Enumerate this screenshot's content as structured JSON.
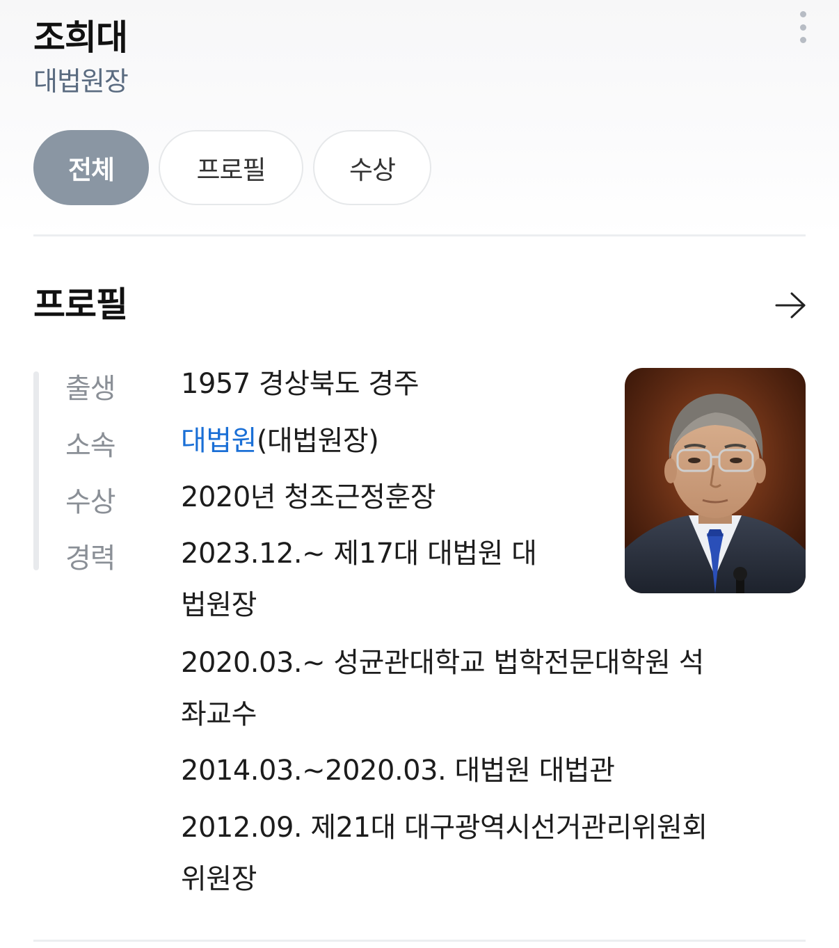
{
  "header": {
    "name": "조희대",
    "title": "대법원장",
    "more_icon": "more-vertical-icon"
  },
  "tabs": [
    {
      "label": "전체",
      "active": true
    },
    {
      "label": "프로필",
      "active": false
    },
    {
      "label": "수상",
      "active": false
    }
  ],
  "profile": {
    "section_title": "프로필",
    "more_arrow_icon": "arrow-right-icon",
    "rows": {
      "birth": {
        "label": "출생",
        "value": "1957 경상북도 경주"
      },
      "affiliation": {
        "label": "소속",
        "link": "대법원",
        "suffix": "(대법원장)"
      },
      "award": {
        "label": "수상",
        "value": "2020년 청조근정훈장"
      },
      "career": {
        "label": "경력",
        "items": [
          {
            "line1": "2023.12.~ 제17대 대법원 대",
            "line2": "법원장"
          },
          {
            "line1": "2020.03.~ 성균관대학교 법학전문대학원 석",
            "line2": "좌교수"
          },
          {
            "line1": "2014.03.~2020.03. 대법원 대법관",
            "line2": ""
          },
          {
            "line1": "2012.09. 제21대 대구광역시선거관리위원회",
            "line2": "위원장"
          }
        ]
      }
    },
    "photo_icon": "portrait-photo"
  },
  "colors": {
    "active_tab": "#8a96a3",
    "link": "#1a6fd6",
    "subtitle": "#5a6b80"
  }
}
